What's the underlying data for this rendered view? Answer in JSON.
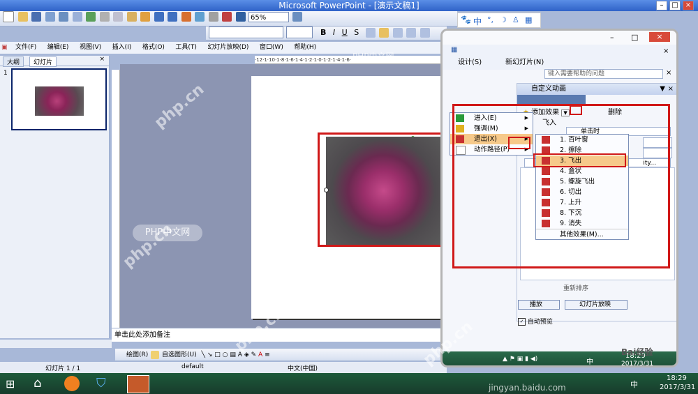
{
  "window": {
    "title": "Microsoft PowerPoint - [演示文稿1]",
    "zoom": "65%"
  },
  "ime_bar": {
    "label": "中"
  },
  "menu": [
    "文件(F)",
    "编辑(E)",
    "视图(V)",
    "插入(I)",
    "格式(O)",
    "工具(T)",
    "幻灯片放映(D)",
    "窗口(W)",
    "帮助(H)"
  ],
  "help_box": {
    "placeholder": "键入需要帮助的问题"
  },
  "left_tabs": [
    "大纲",
    "幻灯片"
  ],
  "slide_number": "1",
  "notes_placeholder": "单击此处添加备注",
  "drawing_toolbar": {
    "draw": "绘图(R)",
    "autoshapes": "自选图形(U)"
  },
  "status": {
    "slide": "幻灯片 1 / 1",
    "design": "default",
    "language": "中文(中国)"
  },
  "overlay_toolbar": {
    "design": "设计(S)",
    "new_slide": "新幻灯片(N)"
  },
  "task_pane": {
    "title": "自定义动画",
    "add_effect": "添加效果",
    "delete": "删除",
    "fly_in": "飞入",
    "start_value": "单击时",
    "speed_value": "ity...",
    "reorder": "重新排序",
    "play": "播放",
    "slideshow": "幻灯片放映",
    "autopreview": "自动预览"
  },
  "effect_menu": [
    "进入(E)",
    "强调(M)",
    "退出(X)",
    "动作路径(P)"
  ],
  "exit_submenu": [
    "1. 百叶窗",
    "2. 擦除",
    "3. 飞出",
    "4. 盒状",
    "5. 螺旋飞出",
    "6. 切出",
    "7. 上升",
    "8. 下沉",
    "9. 消失"
  ],
  "exit_more": "其他效果(M)...",
  "overlay_taskbar": {
    "ime": "中",
    "time": "18:29",
    "date": "2017/3/31"
  },
  "taskbar": {
    "ime": "中",
    "time": "18:29",
    "date": "2017/3/31"
  },
  "watermarks": {
    "site": "php.cn",
    "brand": "PHP中文网",
    "baidu": "Bai经验",
    "baidu_url": "jingyan.baidu.com"
  }
}
